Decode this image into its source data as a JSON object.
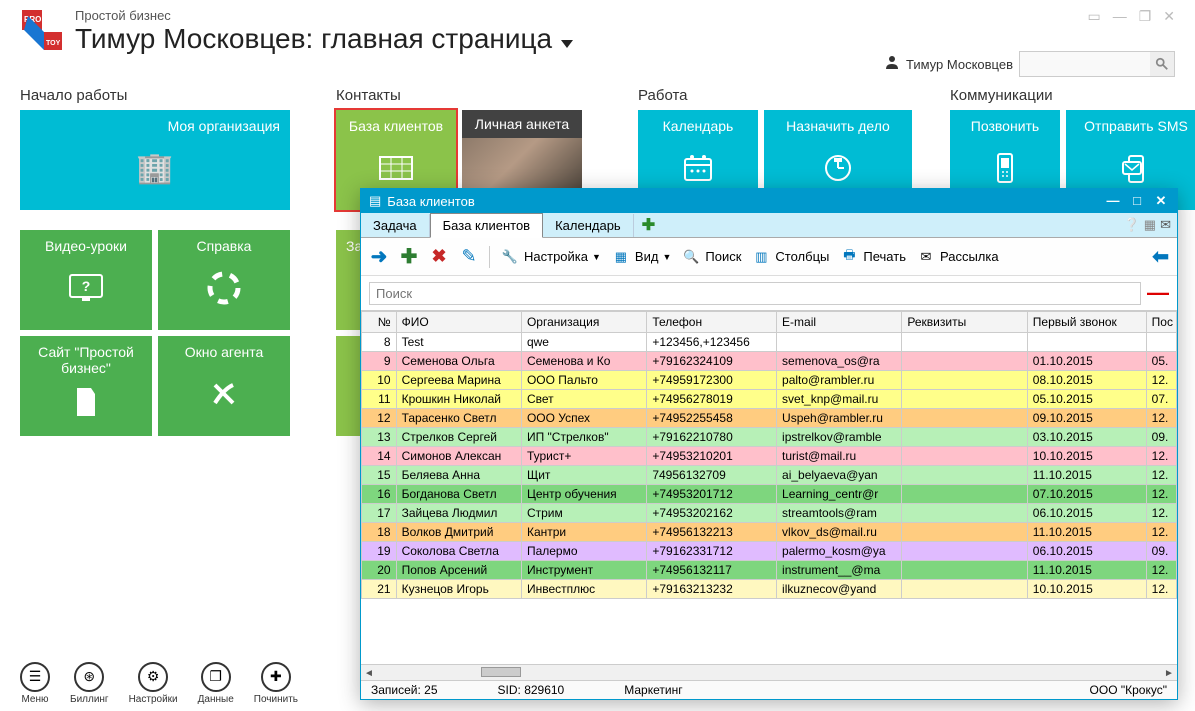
{
  "app_name": "Простой бизнес",
  "page_title": "Тимур Московцев: главная страница",
  "user_name": "Тимур Московцев",
  "sections": {
    "start": {
      "title": "Начало работы",
      "my_org": "Моя организация",
      "video": "Видео-уроки",
      "help": "Справка",
      "site": "Сайт \"Простой бизнес\"",
      "agent": "Окно агента"
    },
    "contacts": {
      "title": "Контакты",
      "clients_db": "База клиентов",
      "personal": "Личная анкета",
      "tasks_short": "Зад"
    },
    "work": {
      "title": "Работа",
      "calendar": "Календарь",
      "assign": "Назначить дело"
    },
    "comm": {
      "title": "Коммуникации",
      "call": "Позвонить",
      "sms": "Отправить SMS"
    }
  },
  "bottom": {
    "menu": "Меню",
    "billing": "Биллинг",
    "settings": "Настройки",
    "data": "Данные",
    "fix": "Починить"
  },
  "modal": {
    "title": "База клиентов",
    "tabs": {
      "task": "Задача",
      "db": "База клиентов",
      "calendar": "Календарь"
    },
    "toolbar": {
      "settings": "Настройка",
      "view": "Вид",
      "search": "Поиск",
      "columns": "Столбцы",
      "print": "Печать",
      "mailing": "Рассылка"
    },
    "search_placeholder": "Поиск",
    "columns": {
      "num": "№",
      "fio": "ФИО",
      "org": "Организация",
      "tel": "Телефон",
      "email": "E-mail",
      "req": "Реквизиты",
      "first": "Первый звонок",
      "last": "Пос"
    },
    "rows": [
      {
        "n": 8,
        "fio": "Test",
        "org": "qwe",
        "tel": "+123456,+123456",
        "email": "",
        "req": "",
        "first": "",
        "last": "",
        "cls": ""
      },
      {
        "n": 9,
        "fio": "Семенова Ольга",
        "org": "Семенова и Ко",
        "tel": "+79162324109",
        "email": "semenova_os@ra",
        "req": "",
        "first": "01.10.2015",
        "last": "05.",
        "cls": "row-pink"
      },
      {
        "n": 10,
        "fio": "Сергеева Марина",
        "org": "ООО Пальто",
        "tel": "+74959172300",
        "email": "palto@rambler.ru",
        "req": "",
        "first": "08.10.2015",
        "last": "12.",
        "cls": "row-yellow"
      },
      {
        "n": 11,
        "fio": "Крошкин Николай",
        "org": "Свет",
        "tel": "+74956278019",
        "email": "svet_knp@mail.ru",
        "req": "",
        "first": "05.10.2015",
        "last": "07.",
        "cls": "row-yellow"
      },
      {
        "n": 12,
        "fio": "Тарасенко Светл",
        "org": "ООО Успех",
        "tel": "+74952255458",
        "email": "Uspeh@rambler.ru",
        "req": "",
        "first": "09.10.2015",
        "last": "12.",
        "cls": "row-orange"
      },
      {
        "n": 13,
        "fio": "Стрелков Сергей",
        "org": "ИП \"Стрелков\"",
        "tel": "+79162210780",
        "email": "ipstrelkov@ramble",
        "req": "",
        "first": "03.10.2015",
        "last": "09.",
        "cls": "row-lightgreen"
      },
      {
        "n": 14,
        "fio": "Симонов Алексан",
        "org": "Турист+",
        "tel": "+74953210201",
        "email": "turist@mail.ru",
        "req": "",
        "first": "10.10.2015",
        "last": "12.",
        "cls": "row-pink"
      },
      {
        "n": 15,
        "fio": "Беляева Анна",
        "org": "Щит",
        "tel": "74956132709",
        "email": "ai_belyaeva@yan",
        "req": "",
        "first": "11.10.2015",
        "last": "12.",
        "cls": "row-lightgreen"
      },
      {
        "n": 16,
        "fio": "Богданова Светл",
        "org": "Центр обучения",
        "tel": "+74953201712",
        "email": "Learning_centr@r",
        "req": "",
        "first": "07.10.2015",
        "last": "12.",
        "cls": "row-green"
      },
      {
        "n": 17,
        "fio": "Зайцева Людмил",
        "org": "Стрим",
        "tel": "+74953202162",
        "email": "streamtools@ram",
        "req": "",
        "first": "06.10.2015",
        "last": "12.",
        "cls": "row-lightgreen"
      },
      {
        "n": 18,
        "fio": "Волков Дмитрий",
        "org": "Кантри",
        "tel": "+74956132213",
        "email": "vlkov_ds@mail.ru",
        "req": "",
        "first": "11.10.2015",
        "last": "12.",
        "cls": "row-orange"
      },
      {
        "n": 19,
        "fio": "Соколова Светла",
        "org": "Палермо",
        "tel": "+79162331712",
        "email": "palermo_kosm@ya",
        "req": "",
        "first": "06.10.2015",
        "last": "09.",
        "cls": "row-purple"
      },
      {
        "n": 20,
        "fio": "Попов Арсений",
        "org": "Инструмент",
        "tel": "+74956132117",
        "email": "instrument__@ma",
        "req": "",
        "first": "11.10.2015",
        "last": "12.",
        "cls": "row-green"
      },
      {
        "n": 21,
        "fio": "Кузнецов Игорь",
        "org": "Инвестплюс",
        "tel": "+79163213232",
        "email": "ilkuznecov@yand",
        "req": "",
        "first": "10.10.2015",
        "last": "12.",
        "cls": "row-lightyellow"
      }
    ],
    "status": {
      "records": "Записей: 25",
      "sid": "SID: 829610",
      "marketing": "Маркетинг",
      "company": "ООО \"Крокус\""
    }
  }
}
